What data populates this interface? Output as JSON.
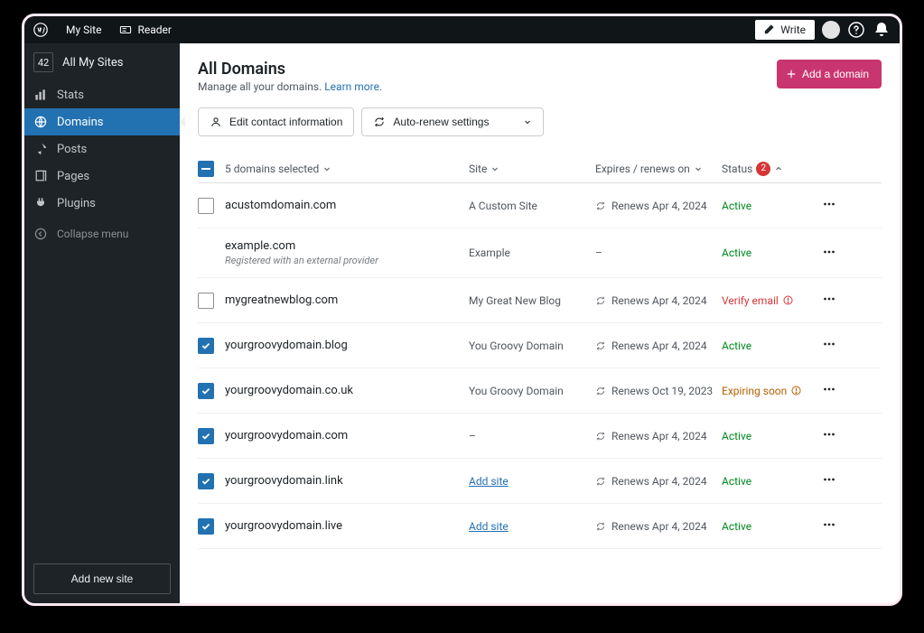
{
  "masterbar": {
    "my_site": "My Site",
    "reader": "Reader",
    "write": "Write"
  },
  "sidebar": {
    "site_count": "42",
    "all_my_sites": "All My Sites",
    "items": [
      {
        "label": "Stats"
      },
      {
        "label": "Domains"
      },
      {
        "label": "Posts"
      },
      {
        "label": "Pages"
      },
      {
        "label": "Plugins"
      }
    ],
    "collapse": "Collapse menu",
    "add_new_site": "Add new site"
  },
  "header": {
    "title": "All Domains",
    "subtitle_prefix": "Manage all your domains. ",
    "learn_more": "Learn more.",
    "add_domain": "Add a domain"
  },
  "toolbar": {
    "edit_contact": "Edit contact information",
    "auto_renew": "Auto-renew settings"
  },
  "table": {
    "selected_text": "5 domains selected",
    "col_site": "Site",
    "col_expires": "Expires / renews on",
    "col_status": "Status",
    "status_alert_count": "2",
    "rows": [
      {
        "checked": false,
        "check_hidden": false,
        "domain": "acustomdomain.com",
        "domain_sub": "",
        "site": "A Custom Site",
        "site_link": false,
        "renew_icon": true,
        "renew": "Renews Apr 4, 2024",
        "status": "Active",
        "status_type": "active"
      },
      {
        "checked": false,
        "check_hidden": true,
        "domain": "example.com",
        "domain_sub": "Registered with an external provider",
        "site": "Example",
        "site_link": false,
        "renew_icon": false,
        "renew": "–",
        "status": "Active",
        "status_type": "active"
      },
      {
        "checked": false,
        "check_hidden": false,
        "domain": "mygreatnewblog.com",
        "domain_sub": "",
        "site": "My Great New Blog",
        "site_link": false,
        "renew_icon": true,
        "renew": "Renews Apr 4, 2024",
        "status": "Verify email",
        "status_type": "verify"
      },
      {
        "checked": true,
        "check_hidden": false,
        "domain": "yourgroovydomain.blog",
        "domain_sub": "",
        "site": "You Groovy Domain",
        "site_link": false,
        "renew_icon": true,
        "renew": "Renews Apr 4, 2024",
        "status": "Active",
        "status_type": "active"
      },
      {
        "checked": true,
        "check_hidden": false,
        "domain": "yourgroovydomain.co.uk",
        "domain_sub": "",
        "site": "You Groovy Domain",
        "site_link": false,
        "renew_icon": true,
        "renew": "Renews Oct 19, 2023",
        "status": "Expiring soon",
        "status_type": "warn"
      },
      {
        "checked": true,
        "check_hidden": false,
        "domain": "yourgroovydomain.com",
        "domain_sub": "",
        "site": "–",
        "site_link": false,
        "renew_icon": true,
        "renew": "Renews Apr 4, 2024",
        "status": "Active",
        "status_type": "active"
      },
      {
        "checked": true,
        "check_hidden": false,
        "domain": "yourgroovydomain.link",
        "domain_sub": "",
        "site": "Add site",
        "site_link": true,
        "renew_icon": true,
        "renew": "Renews Apr 4, 2024",
        "status": "Active",
        "status_type": "active"
      },
      {
        "checked": true,
        "check_hidden": false,
        "domain": "yourgroovydomain.live",
        "domain_sub": "",
        "site": "Add site",
        "site_link": true,
        "renew_icon": true,
        "renew": "Renews Apr 4, 2024",
        "status": "Active",
        "status_type": "active"
      }
    ]
  }
}
